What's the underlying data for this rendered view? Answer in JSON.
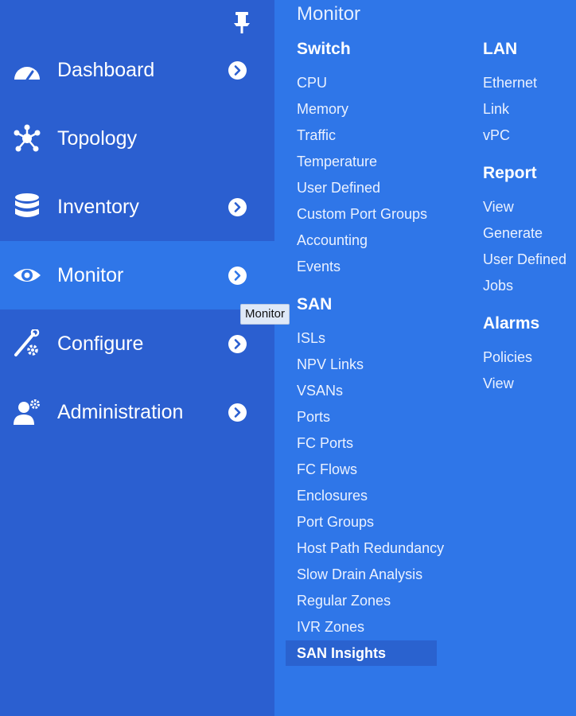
{
  "sidebar": {
    "pin_icon": "pin-icon",
    "items": [
      {
        "id": "dashboard",
        "label": "Dashboard",
        "icon": "dashboard-gauge-icon",
        "has_submenu": true,
        "active": false
      },
      {
        "id": "topology",
        "label": "Topology",
        "icon": "topology-hub-icon",
        "has_submenu": false,
        "active": false
      },
      {
        "id": "inventory",
        "label": "Inventory",
        "icon": "database-icon",
        "has_submenu": true,
        "active": false
      },
      {
        "id": "monitor",
        "label": "Monitor",
        "icon": "eye-icon",
        "has_submenu": true,
        "active": true
      },
      {
        "id": "configure",
        "label": "Configure",
        "icon": "wrench-gear-icon",
        "has_submenu": true,
        "active": false
      },
      {
        "id": "administration",
        "label": "Administration",
        "icon": "user-gear-icon",
        "has_submenu": true,
        "active": false
      }
    ]
  },
  "tooltip": {
    "text": "Monitor"
  },
  "flyout": {
    "title": "Monitor",
    "left_column": [
      {
        "heading": "Switch",
        "links": [
          "CPU",
          "Memory",
          "Traffic",
          "Temperature",
          "User Defined",
          "Custom Port Groups",
          "Accounting",
          "Events"
        ]
      },
      {
        "heading": "SAN",
        "links": [
          "ISLs",
          "NPV Links",
          "VSANs",
          "Ports",
          "FC Ports",
          "FC Flows",
          "Enclosures",
          "Port Groups",
          "Host Path Redundancy",
          "Slow Drain Analysis",
          "Regular Zones",
          "IVR Zones",
          "SAN Insights"
        ]
      }
    ],
    "right_column": [
      {
        "heading": "LAN",
        "links": [
          "Ethernet",
          "Link",
          "vPC"
        ]
      },
      {
        "heading": "Report",
        "links": [
          "View",
          "Generate",
          "User Defined",
          "Jobs"
        ]
      },
      {
        "heading": "Alarms",
        "links": [
          "Policies",
          "View"
        ]
      }
    ],
    "selected": "SAN Insights"
  },
  "colors": {
    "sidebar_bg": "#2b5fd0",
    "active_bg": "#2f76e8",
    "selected_link_bg": "#2a62cf",
    "text": "#ffffff"
  }
}
